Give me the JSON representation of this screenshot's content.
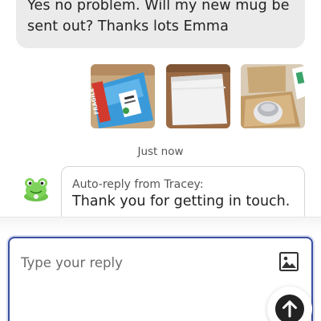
{
  "conversation": {
    "outgoing_message": "Yes no problem. Will my new mug be sent out? Thanks lots Emma",
    "attachments": [
      {
        "icon": "parcel-fragile-photo",
        "label": "FRAGILE"
      },
      {
        "icon": "white-box-photo"
      },
      {
        "icon": "open-box-mug-photo"
      }
    ],
    "timestamp": "Just now",
    "auto_reply": {
      "label": "Auto-reply from Tracey:",
      "text": "Thank you for getting in touch.",
      "avatar_icon": "frog-avatar"
    }
  },
  "composer": {
    "placeholder": "Type your reply",
    "image_icon": "image-icon",
    "send_icon": "arrow-up-icon",
    "accent_color": "#3b4fa0"
  }
}
